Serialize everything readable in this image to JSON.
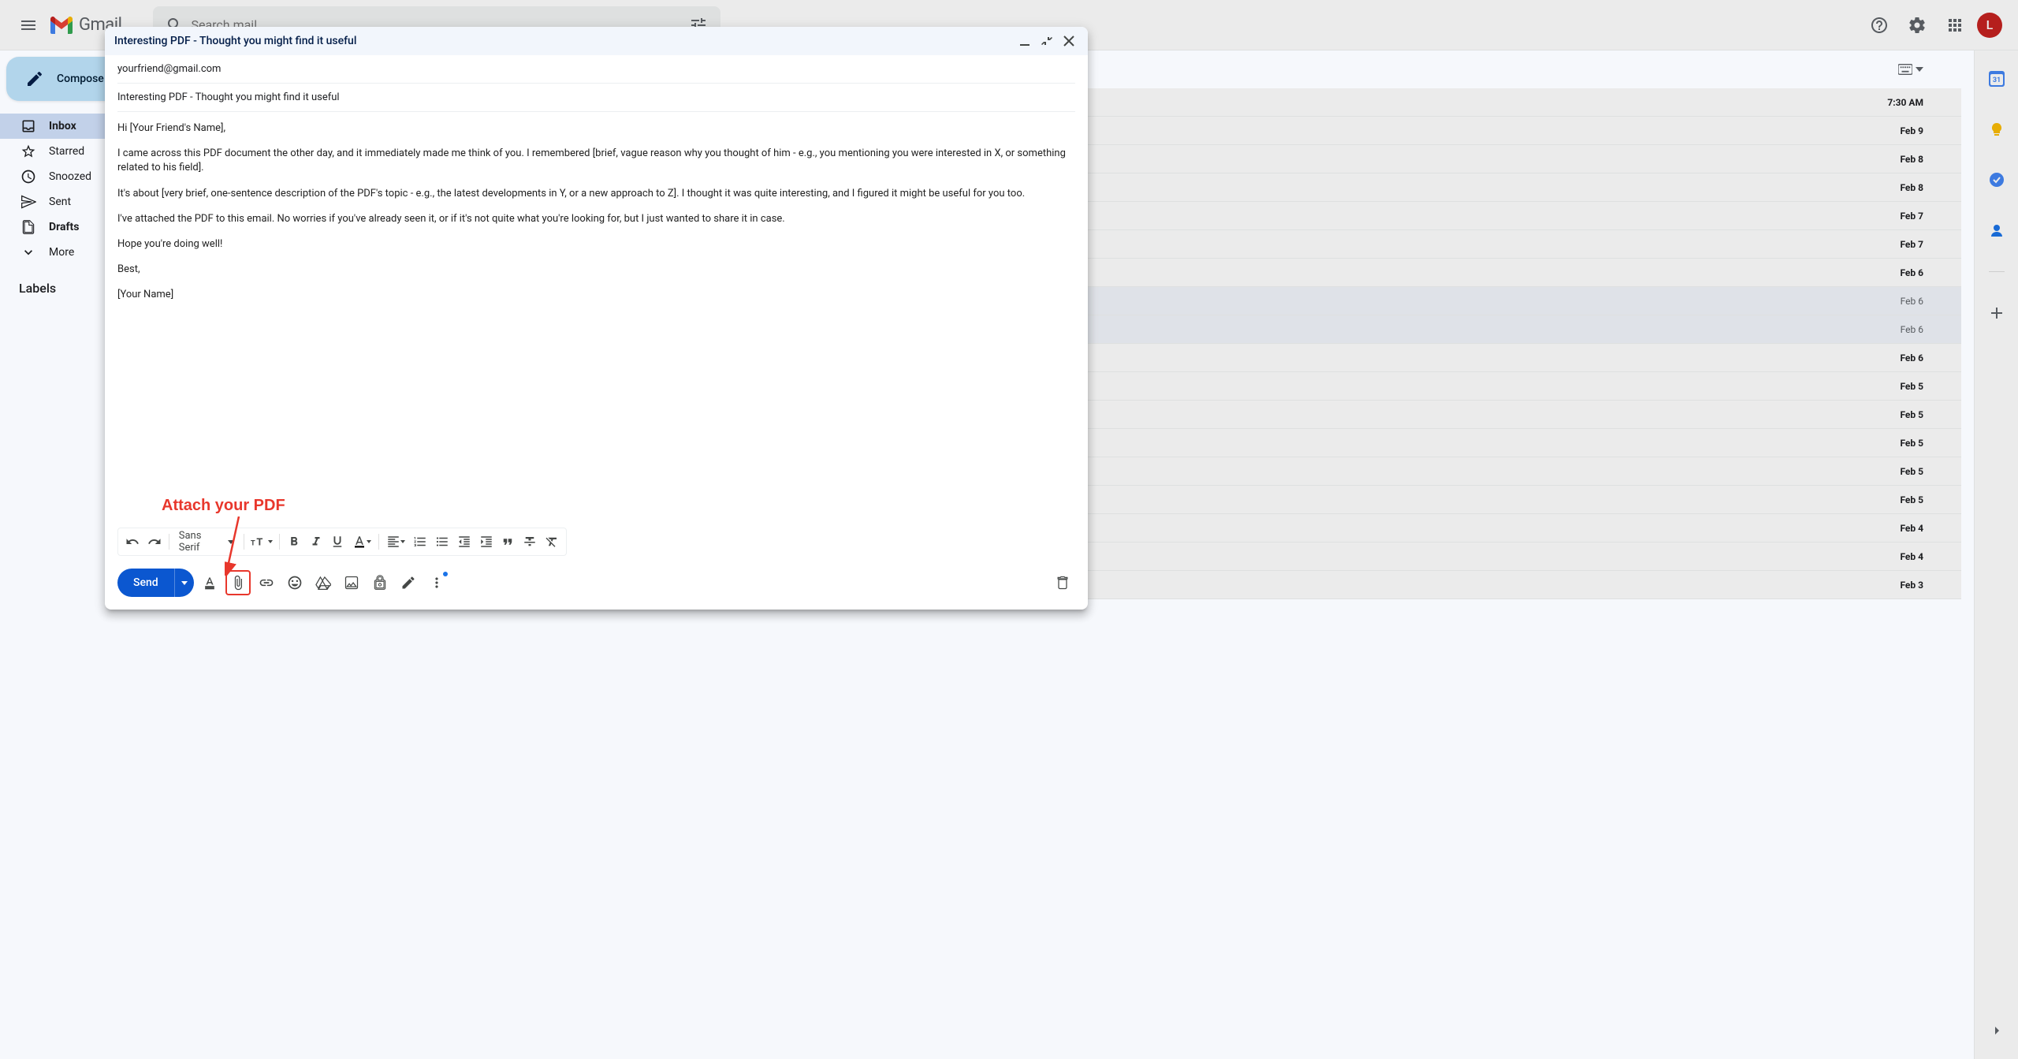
{
  "header": {
    "logo_text": "Gmail",
    "search_placeholder": "Search mail",
    "avatar_letter": "L"
  },
  "sidebar": {
    "compose_label": "Compose",
    "items": [
      {
        "icon": "inbox",
        "label": "Inbox",
        "active": true,
        "bold": true
      },
      {
        "icon": "star",
        "label": "Starred",
        "active": false,
        "bold": false
      },
      {
        "icon": "clock",
        "label": "Snoozed",
        "active": false,
        "bold": false
      },
      {
        "icon": "send",
        "label": "Sent",
        "active": false,
        "bold": false
      },
      {
        "icon": "file",
        "label": "Drafts",
        "active": false,
        "bold": true
      },
      {
        "icon": "chevron-down",
        "label": "More",
        "active": false,
        "bold": false
      }
    ],
    "labels_header": "Labels"
  },
  "mail_dates": [
    {
      "date": "7:30 AM",
      "unread": true
    },
    {
      "date": "Feb 9",
      "unread": true
    },
    {
      "date": "Feb 8",
      "unread": true
    },
    {
      "date": "Feb 8",
      "unread": true
    },
    {
      "date": "Feb 7",
      "unread": true
    },
    {
      "date": "Feb 7",
      "unread": true
    },
    {
      "date": "Feb 6",
      "unread": true
    },
    {
      "date": "Feb 6",
      "unread": false
    },
    {
      "date": "Feb 6",
      "unread": false
    },
    {
      "date": "Feb 6",
      "unread": true
    },
    {
      "date": "Feb 5",
      "unread": true
    },
    {
      "date": "Feb 5",
      "unread": true
    },
    {
      "date": "Feb 5",
      "unread": true
    },
    {
      "date": "Feb 5",
      "unread": true
    },
    {
      "date": "Feb 5",
      "unread": true
    },
    {
      "date": "Feb 4",
      "unread": true
    },
    {
      "date": "Feb 4",
      "unread": true
    },
    {
      "date": "Feb 3",
      "unread": true
    }
  ],
  "compose": {
    "title": "Interesting PDF - Thought you might find it useful",
    "to": "yourfriend@gmail.com",
    "subject": "Interesting PDF - Thought you might find it useful",
    "body": {
      "greeting": "Hi [Your Friend's Name],",
      "p1": "I came across this PDF document the other day, and it immediately made me think of you. I remembered [brief, vague reason why you thought of him - e.g., you mentioning you were interested in X, or something related to his field].",
      "p2": "It's about [very brief, one-sentence description of the PDF's topic - e.g., the latest developments in Y, or a new approach to Z]. I thought it was quite interesting, and I figured it might be useful for you too.",
      "p3": "I've attached the PDF to this email. No worries if you've already seen it, or if it's not quite what you're looking for, but I just wanted to share it in case.",
      "p4": "Hope you're doing well!",
      "closing": "Best,",
      "signature": "[Your Name]"
    },
    "font_label": "Sans Serif",
    "send_label": "Send"
  },
  "annotation": {
    "label": "Attach your PDF"
  },
  "colors": {
    "primary": "#0b57d0",
    "annotation": "#e8372c",
    "sidebar_active": "#d3e3fd",
    "compose_btn": "#c2e7ff"
  }
}
